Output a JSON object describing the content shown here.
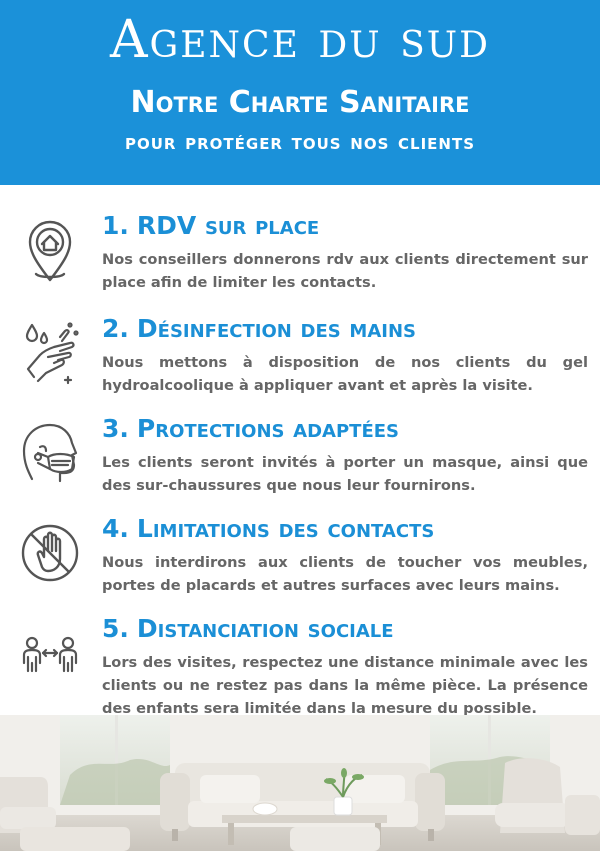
{
  "header": {
    "agency": "Agence du sud",
    "charter": "Notre Charte Sanitaire",
    "subtitle": "pour protéger tous nos clients"
  },
  "items": [
    {
      "number": "1.",
      "title": "RDV sur place",
      "text": "Nos conseillers donnerons rdv aux clients directement sur place afin de limiter les contacts.",
      "icon": "location-pin-house-icon"
    },
    {
      "number": "2.",
      "title": "Désinfection des mains",
      "text": "Nous mettons à disposition de nos clients du gel hydroalcoolique à appliquer avant et après la visite.",
      "icon": "hand-washing-icon"
    },
    {
      "number": "3.",
      "title": "Protections adaptées",
      "text": "Les clients seront invités à porter un masque, ainsi que des sur-chaussures que nous leur fournirons.",
      "icon": "face-mask-icon"
    },
    {
      "number": "4.",
      "title": "Limitations des contacts",
      "text": "Nous interdirons aux clients de toucher vos meubles, portes de placards et autres surfaces avec leurs mains.",
      "icon": "no-touch-hand-icon"
    },
    {
      "number": "5.",
      "title": "Distanciation sociale",
      "text": "Lors des visites, respectez une distance minimale avec les clients ou ne restez pas dans la même pièce. La présence des enfants sera limitée dans la mesure du possible.",
      "icon": "social-distance-icon"
    }
  ],
  "colors": {
    "header_bg": "#1b91d9",
    "title_blue": "#1b8fd6",
    "body_grey": "#666666",
    "icon_grey": "#555555"
  }
}
